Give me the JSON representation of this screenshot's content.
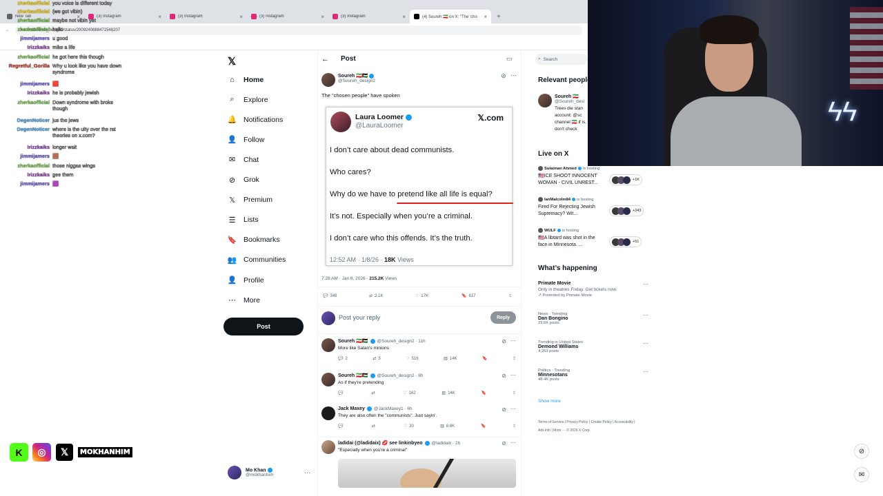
{
  "browser": {
    "tabs": [
      {
        "title": "New Tab",
        "active": false,
        "favicon_color": "#5f6368"
      },
      {
        "title": "(3) Instagram",
        "active": false,
        "favicon_color": "#dd2a7b"
      },
      {
        "title": "(3) Instagram",
        "active": false,
        "favicon_color": "#dd2a7b"
      },
      {
        "title": "(3) Instagram",
        "active": false,
        "favicon_color": "#dd2a7b"
      },
      {
        "title": "(3) Instagram",
        "active": false,
        "favicon_color": "#dd2a7b"
      },
      {
        "title": "(4) Soureh 🇮🇷 on X: \"The 'cho",
        "active": true,
        "favicon_color": "#000000"
      }
    ],
    "new_tab_icon": "+",
    "url": "x.com/Soureh_design2/status/2009240688471548207"
  },
  "chat": {
    "messages": [
      {
        "user": "zherkaofficial",
        "text": "you voice is different today",
        "color": "#ffd400"
      },
      {
        "user": "zherkaofficial",
        "text": "(we got vibin)",
        "color": "#ffd400"
      },
      {
        "user": "zherkaofficial",
        "text": "maybe not vibin yet",
        "color": "#6fbf44"
      },
      {
        "user": "zherkaofficial",
        "text": "hello",
        "color": "#6fbf44"
      },
      {
        "user": "jimmijamers",
        "text": "u good",
        "color": "#6b5bd6"
      },
      {
        "user": "Irizzkaiks",
        "text": "mike a life",
        "color": "#8e44ad"
      },
      {
        "user": "zherkaofficial",
        "text": "he got here this though",
        "color": "#6fbf44"
      },
      {
        "user": "Regretful_Gorilla",
        "text": "Why u look like you have down syndrome",
        "color": "#c0392b"
      },
      {
        "user": "jimmijamers",
        "text": "🟥",
        "color": "#6b5bd6"
      },
      {
        "user": "Irizzkaiks",
        "text": "he is probably jewish",
        "color": "#8e44ad"
      },
      {
        "user": "zherkaofficial",
        "text": "Down syndrome with broke though",
        "color": "#6fbf44"
      },
      {
        "user": "DegenNoticer",
        "text": "jus the jews",
        "color": "#4aa3df"
      },
      {
        "user": "DegenNoticer",
        "text": "where is the ulty over the rat theories on x.com?",
        "color": "#4aa3df"
      },
      {
        "user": "Irizzkaiks",
        "text": "longer wait",
        "color": "#8e44ad"
      },
      {
        "user": "jimmijamers",
        "text": "🟫",
        "color": "#6b5bd6"
      },
      {
        "user": "zherkaofficial",
        "text": "those niggas wings",
        "color": "#6fbf44"
      },
      {
        "user": "Irizzkaiks",
        "text": "gee them",
        "color": "#8e44ad"
      },
      {
        "user": "jimmijamers",
        "text": "🟪",
        "color": "#6b5bd6"
      }
    ]
  },
  "nav": {
    "logo": "𝕏",
    "items": [
      {
        "label": "Home",
        "icon": "⌂",
        "name": "home"
      },
      {
        "label": "Explore",
        "icon": "⌕",
        "name": "explore"
      },
      {
        "label": "Notifications",
        "icon": "🔔",
        "name": "notifications",
        "badge": "4"
      },
      {
        "label": "Follow",
        "icon": "👤",
        "name": "follow"
      },
      {
        "label": "Chat",
        "icon": "✉",
        "name": "chat"
      },
      {
        "label": "Grok",
        "icon": "⊘",
        "name": "grok"
      },
      {
        "label": "Premium",
        "icon": "𝕏",
        "name": "premium"
      },
      {
        "label": "Lists",
        "icon": "☰",
        "name": "lists"
      },
      {
        "label": "Bookmarks",
        "icon": "🔖",
        "name": "bookmarks"
      },
      {
        "label": "Communities",
        "icon": "👥",
        "name": "communities"
      },
      {
        "label": "Profile",
        "icon": "👤",
        "name": "profile"
      },
      {
        "label": "More",
        "icon": "⋯",
        "name": "more"
      }
    ],
    "post_button": "Post",
    "user": {
      "name": "Mo Khan",
      "handle": "@mokhanhim"
    }
  },
  "post": {
    "header": "Post",
    "author": {
      "name": "Soureh 🇮🇷🇵🇸",
      "handle": "@Soureh_design2"
    },
    "text": "The \"chosen people\" have spoken",
    "embed": {
      "name": "Laura Loomer",
      "handle": "@LauraLoomer",
      "brand": "𝕏.com",
      "lines": [
        "I don’t care about dead communists.",
        "Who cares?",
        "Why do we have to pretend like all life is equal?",
        "It’s not. Especially when you’re a criminal.",
        "I don’t care who this offends. It’s the truth."
      ],
      "footer_time": "12:52 AM · 1/8/26 · ",
      "footer_views": "18K",
      "footer_views_label": " Views",
      "underline_color": "#e0201b"
    },
    "meta_time": "7:28 AM · Jan 8, 2026 · ",
    "meta_views": "215.2K",
    "meta_views_label": " Views",
    "stats": {
      "replies": "348",
      "reposts": "2.1K",
      "likes": "17K",
      "bookmarks": "617"
    },
    "reply_placeholder": "Post your reply",
    "reply_button": "Reply"
  },
  "replies": [
    {
      "name": "Soureh 🇮🇷🇵🇸",
      "handle": "@Soureh_design2 · 11h",
      "text": "More like Satan's minions",
      "stats": {
        "replies": "2",
        "reposts": "5",
        "likes": "516",
        "views": "14K"
      }
    },
    {
      "name": "Soureh 🇮🇷🇵🇸",
      "handle": "@Soureh_design2 · 8h",
      "text": "As if they're pretending",
      "stats": {
        "replies": "",
        "reposts": "",
        "likes": "162",
        "views": "14K"
      }
    },
    {
      "name": "Jack Maxey",
      "handle": "@JackMaxey1 · 6h",
      "text": "They are also often the \"communists\". Just sayin'.",
      "stats": {
        "replies": "",
        "reposts": "",
        "likes": "30",
        "views": "8.8K"
      }
    },
    {
      "name": "ladidai (@ladidaix) 💋 see linkinbyeo",
      "handle": "@ladidaix · 2h",
      "text": "\"Especially when you're a criminal\""
    }
  ],
  "right": {
    "search_placeholder": "Search",
    "relevant_title": "Relevant people",
    "relevant_person": {
      "name": "Soureh 🇮🇷",
      "handle": "@Soureh_desi",
      "bio": "Trees die stan account: @sc channel 🇮🇷 if is, don't check"
    },
    "live_title": "Live on X",
    "live": [
      {
        "host": "Sulaiman Ahmed",
        "hosting": "is hosting",
        "title": "🇺🇸ICE SHOOT INNOCENT WOMAN - CIVIL UNREST...",
        "count": "+1K"
      },
      {
        "host": "IanMalcolm84",
        "hosting": "is hosting",
        "title": "Fired For Rejecting Jewish Supremacy? Wit...",
        "count": "+243"
      },
      {
        "host": "WULF",
        "hosting": "is hosting",
        "title": "🇺🇸A libtard was shot in the face in Minnesota. ...",
        "count": "+51"
      }
    ],
    "happening_title": "What’s happening",
    "trends": [
      {
        "cat": "",
        "title": "Primate Movie",
        "desc": "Only in theatres Friday. Get tickets now.",
        "count": "Promoted by Primate Movie"
      },
      {
        "cat": "News · Trending",
        "title": "Dan Bongino",
        "count": "29.6K posts"
      },
      {
        "cat": "Trending in United States",
        "title": "Demond Williams",
        "count": "4,263 posts"
      },
      {
        "cat": "Politics · Trending",
        "title": "Minnesotans",
        "count": "48.4K posts"
      }
    ],
    "show_more": "Show more",
    "footer": [
      "Terms of Service",
      "Privacy Policy",
      "Cookie Policy",
      "Accessibility",
      "Ads info",
      "More ···",
      "© 2026 X Corp."
    ]
  },
  "overlay": {
    "handle": "MOKHANHIM"
  }
}
